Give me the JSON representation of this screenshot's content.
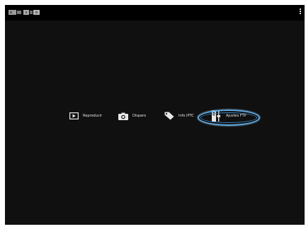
{
  "app": {
    "logo_name": "logo"
  },
  "topbar": {
    "menu_icon": "kebab-menu-icon"
  },
  "menu": {
    "items": [
      {
        "label": "Reproducir",
        "icon": "playback-icon"
      },
      {
        "label": "Disparo",
        "icon": "camera-icon"
      },
      {
        "label": "Info IPTC",
        "icon": "tag-icon"
      },
      {
        "label": "Ajustes FTP",
        "icon": "ftp-settings-icon"
      }
    ],
    "highlighted_item": "Ajustes FTP"
  },
  "colors": {
    "background": "#101010",
    "topbar": "#000000",
    "text": "#e8e8e8",
    "highlight": "#5fa9e0"
  }
}
